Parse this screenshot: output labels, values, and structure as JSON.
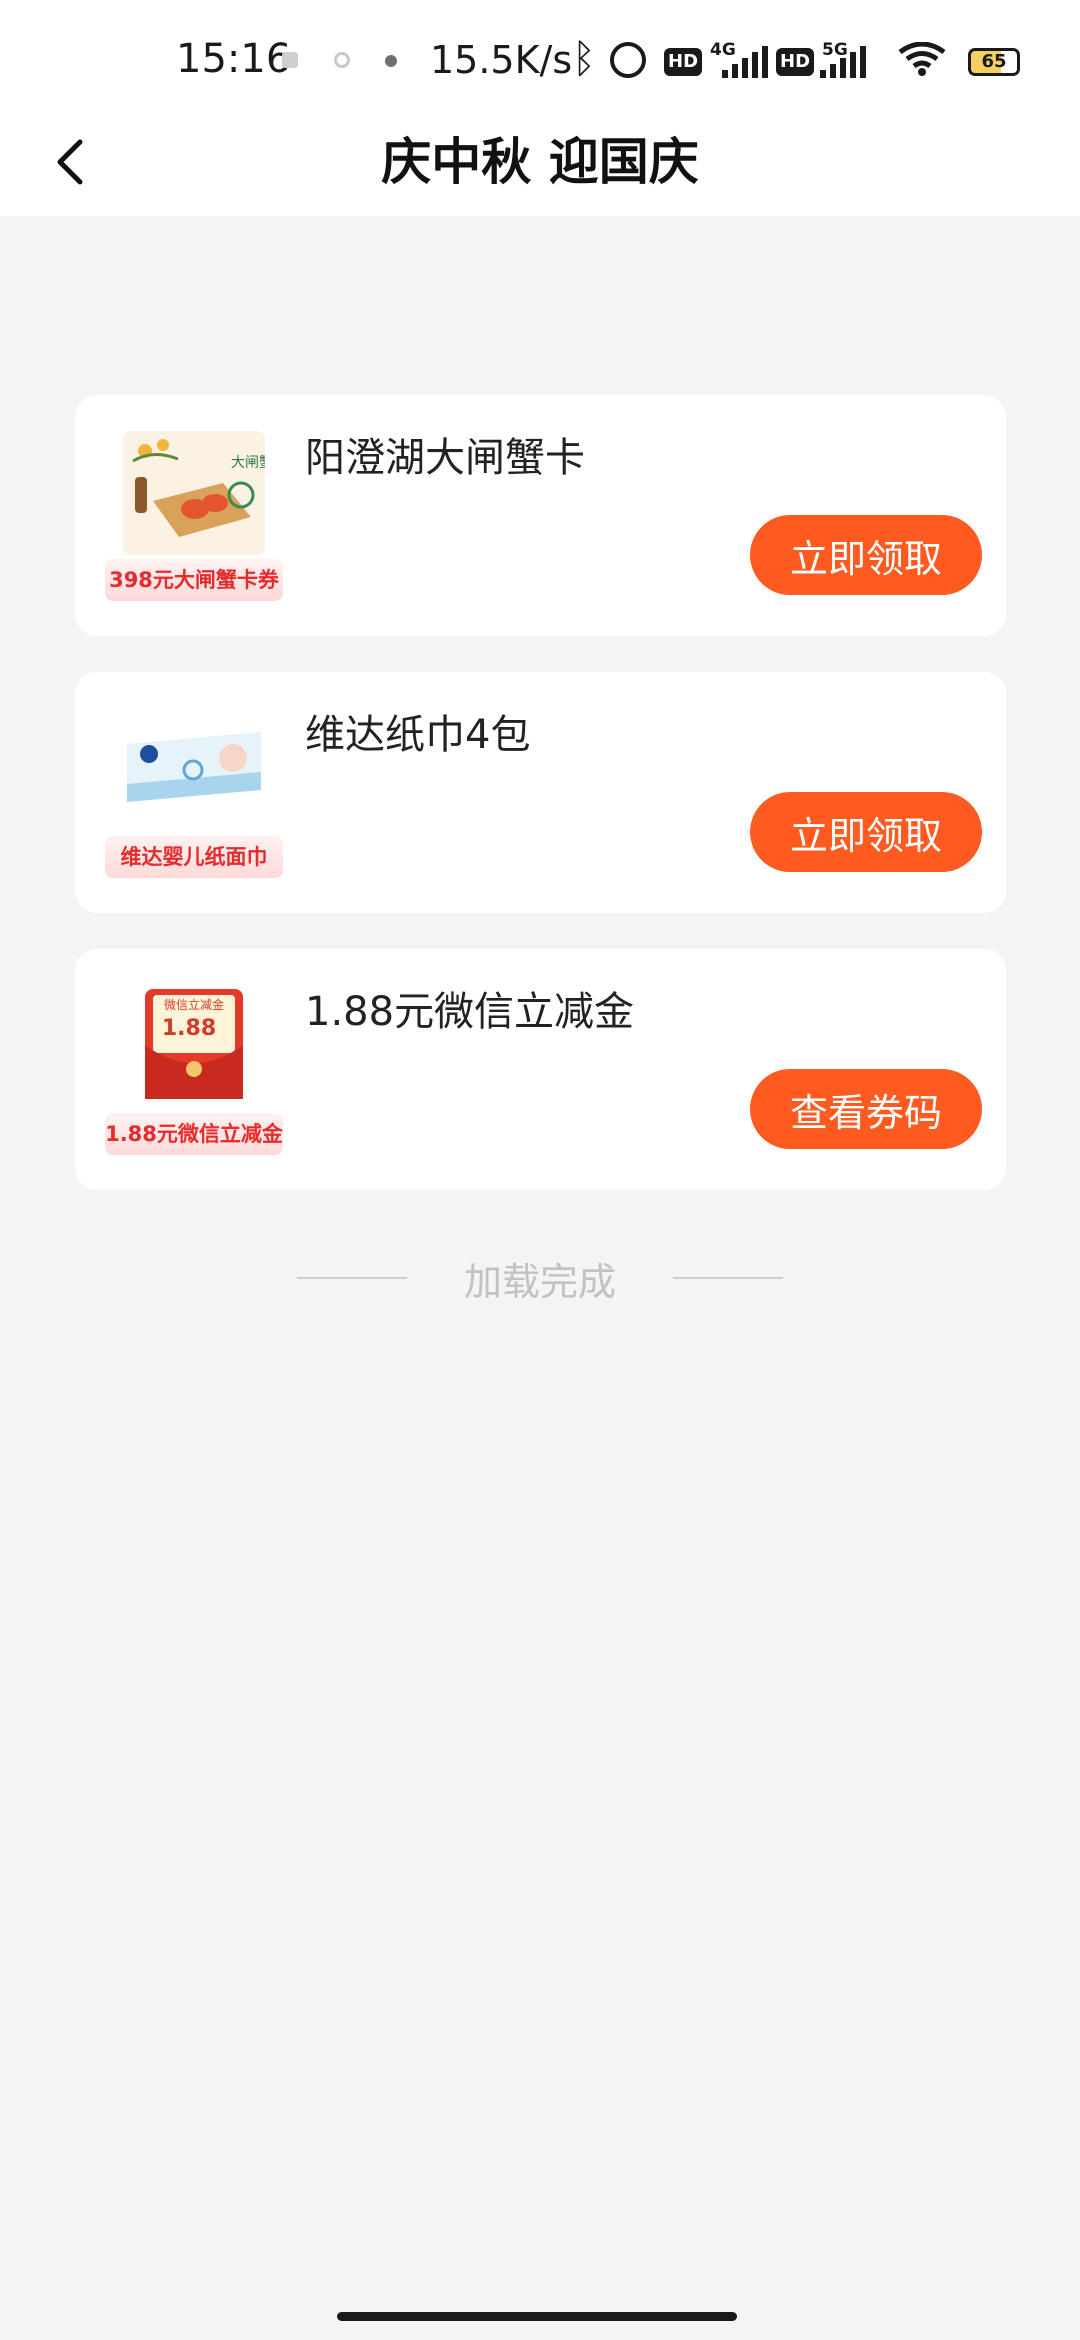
{
  "status_bar": {
    "time": "15:16",
    "net_speed": "15.5K/s",
    "hd_label": "HD",
    "sim1_net": "4G",
    "sim2_net": "5G",
    "battery": "65"
  },
  "header": {
    "title": "庆中秋 迎国庆"
  },
  "coupons": [
    {
      "name": "阳澄湖大闸蟹卡",
      "tag": "398元大闸蟹卡券",
      "action": "立即领取",
      "thumb_text": "大闸蟹"
    },
    {
      "name": "维达纸巾4包",
      "tag": "维达婴儿纸面巾",
      "action": "立即领取"
    },
    {
      "name": "1.88元微信立减金",
      "tag": "1.88元微信立减金",
      "action": "查看券码",
      "thumb_title": "微信立减金",
      "thumb_amount": "1.88"
    }
  ],
  "footer": {
    "end_text": "加载完成"
  },
  "colors": {
    "accent": "#ff5a1f",
    "tag_text": "#e52b2b",
    "background": "#f4f4f4"
  }
}
